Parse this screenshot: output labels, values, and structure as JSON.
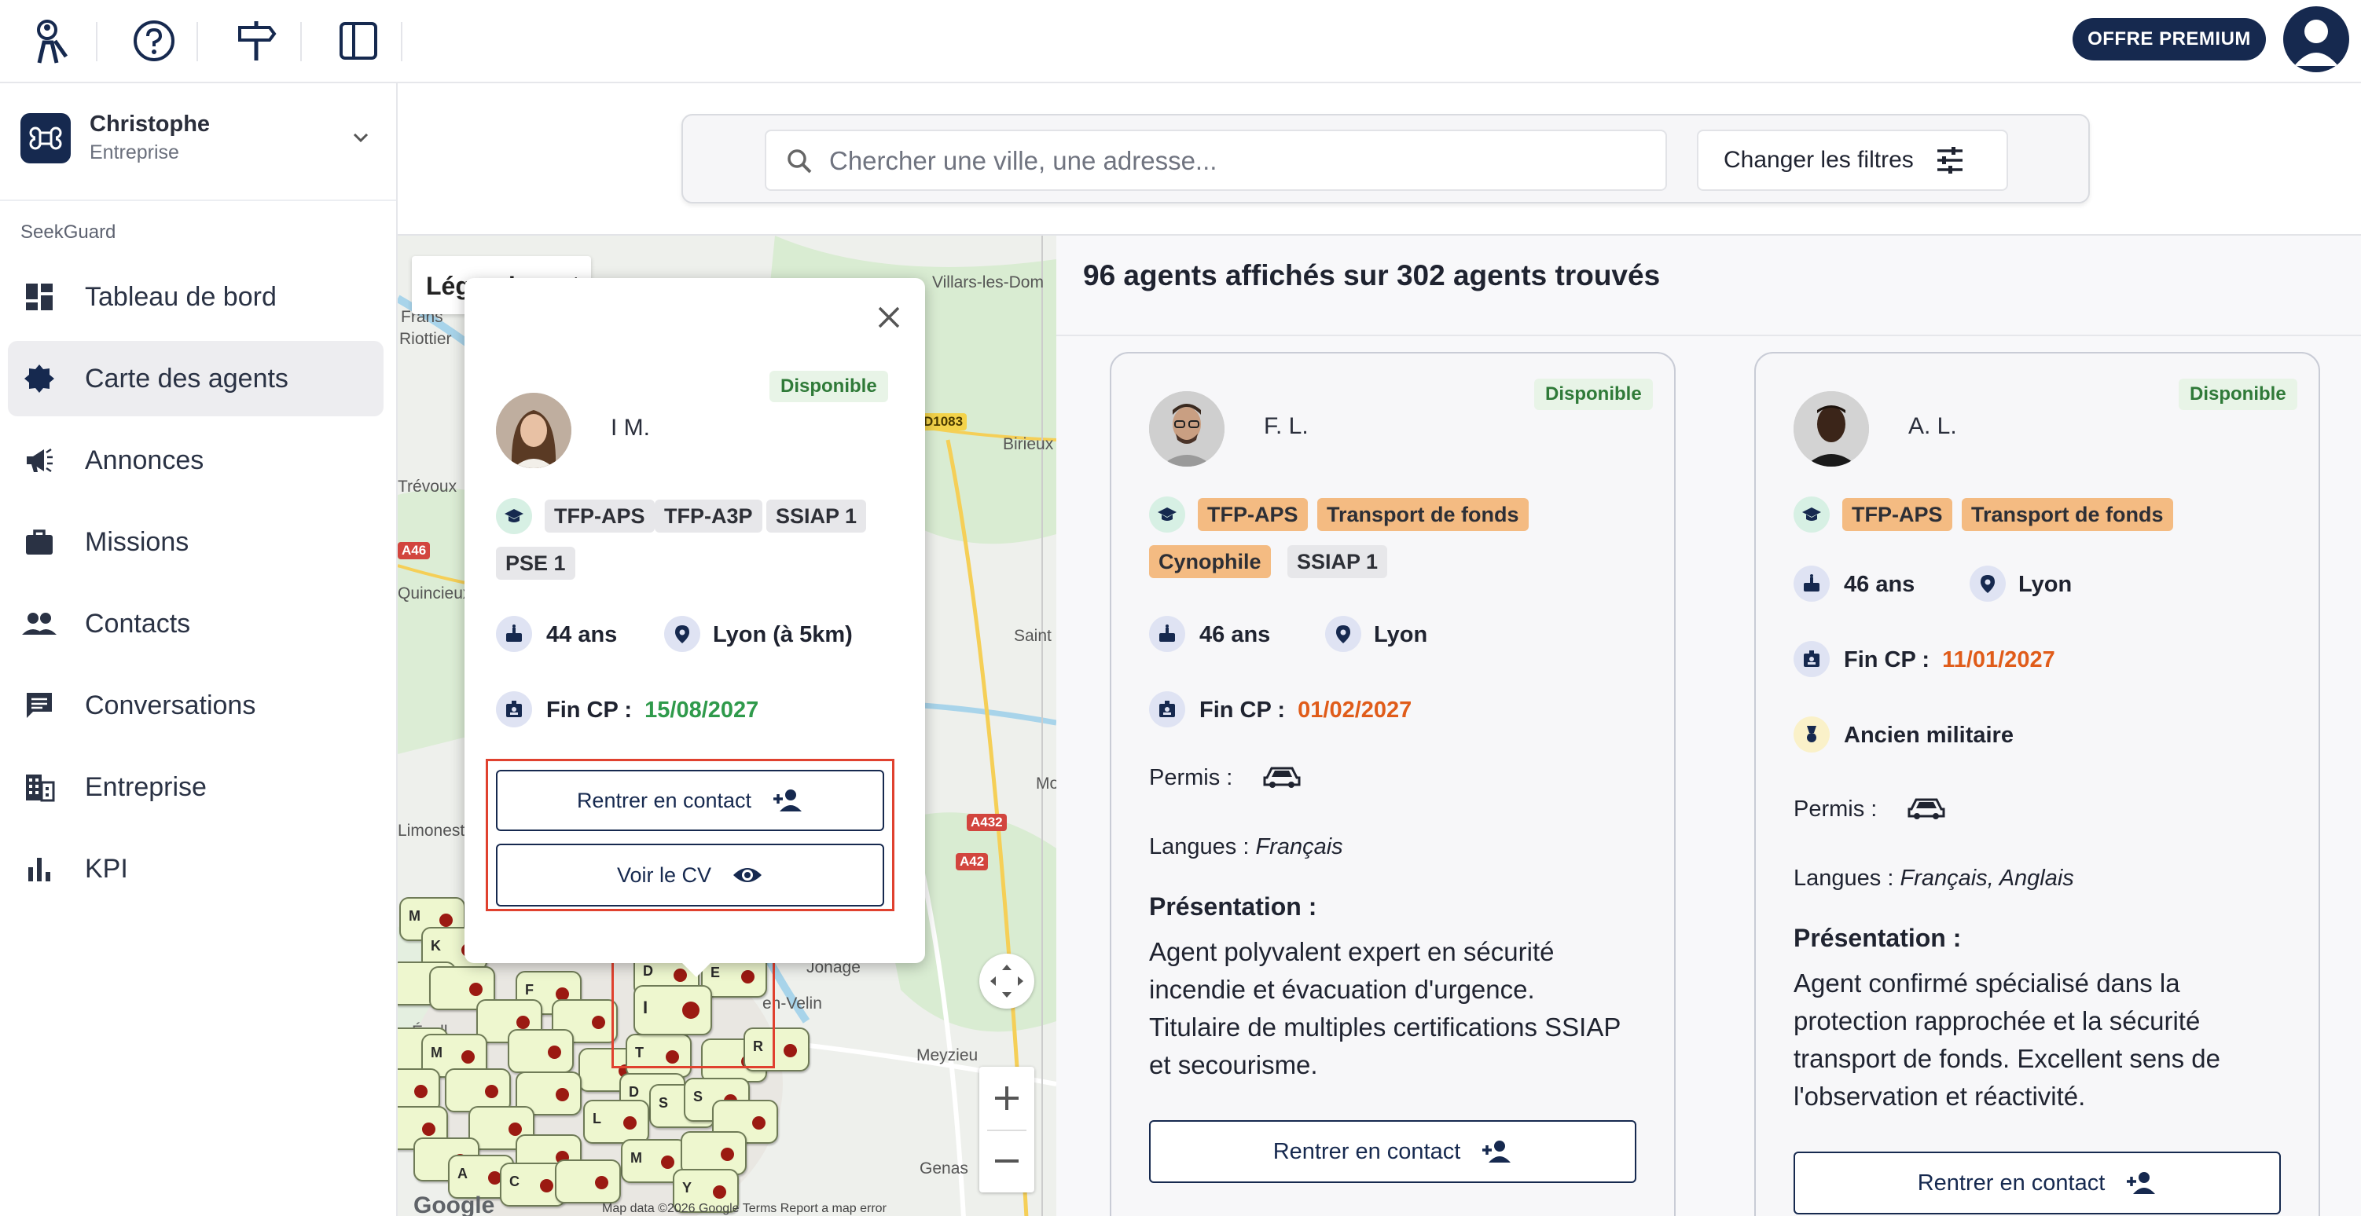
{
  "topbar": {
    "icons": [
      "agent-logo-icon",
      "help-icon",
      "signpost-icon",
      "sidebar-toggle-icon"
    ],
    "premium_label": "OFFRE PREMIUM"
  },
  "org": {
    "name": "Christophe",
    "type": "Entreprise"
  },
  "sidebar": {
    "section": "SeekGuard",
    "items": [
      {
        "label": "Tableau de bord",
        "icon": "dashboard-icon"
      },
      {
        "label": "Carte des agents",
        "icon": "map-badge-icon",
        "active": true
      },
      {
        "label": "Annonces",
        "icon": "megaphone-icon"
      },
      {
        "label": "Missions",
        "icon": "briefcase-icon"
      },
      {
        "label": "Contacts",
        "icon": "people-icon"
      },
      {
        "label": "Conversations",
        "icon": "chat-icon"
      },
      {
        "label": "Entreprise",
        "icon": "building-icon"
      },
      {
        "label": "KPI",
        "icon": "bar-chart-icon"
      }
    ]
  },
  "search": {
    "placeholder": "Chercher une ville, une adresse...",
    "filter_label": "Changer les filtres"
  },
  "map": {
    "legend": "Légende",
    "legend_toggle": "+",
    "places": [
      "Villars-les-Dom",
      "Frans",
      "Riottier",
      "Birieux",
      "Trévoux",
      "Quincieux",
      "Saint",
      "Mo",
      "Limonest",
      "Jonage",
      "en-Velin",
      "Écull",
      "Meyzieu",
      "Genas"
    ],
    "roads": [
      "D1083",
      "A46",
      "A432",
      "A42"
    ],
    "footer": "Map data ©2026 Google   Terms   Report a map error",
    "google": "Google",
    "marker_letters": [
      "M",
      "K",
      "F",
      "D",
      "E",
      "I",
      "R",
      "M",
      "T",
      "D",
      "S",
      "S",
      "L",
      "M",
      "A",
      "Y",
      "C"
    ],
    "popup": {
      "status": "Disponible",
      "name": "I M.",
      "certs": [
        "TFP-APS",
        "TFP-A3P",
        "SSIAP 1",
        "PSE 1"
      ],
      "age": "44 ans",
      "location": "Lyon (à 5km)",
      "fin_cp_label": "Fin CP :",
      "fin_cp_date": "15/08/2027",
      "contact_label": "Rentrer en contact",
      "cv_label": "Voir le CV"
    }
  },
  "results": {
    "summary": "96 agents affichés sur 302 agents trouvés",
    "cards": [
      {
        "status": "Disponible",
        "name": "F. L.",
        "certs": [
          "TFP-APS",
          "Transport de fonds",
          "Cynophile",
          "SSIAP 1"
        ],
        "age": "46 ans",
        "location": "Lyon",
        "fin_cp_label": "Fin CP :",
        "fin_cp_date": "01/02/2027",
        "permis_label": "Permis :",
        "langues_label": "Langues :",
        "langues": "Français",
        "presentation_label": "Présentation :",
        "presentation": "Agent polyvalent expert en sécurité incendie et évacuation d'urgence. Titulaire de multiples certifications SSIAP et secourisme.",
        "contact_label": "Rentrer en contact"
      },
      {
        "status": "Disponible",
        "name": "A. L.",
        "certs": [
          "TFP-APS",
          "Transport de fonds"
        ],
        "age": "46 ans",
        "location": "Lyon",
        "fin_cp_label": "Fin CP :",
        "fin_cp_date": "11/01/2027",
        "military": "Ancien militaire",
        "permis_label": "Permis :",
        "langues_label": "Langues :",
        "langues": "Français, Anglais",
        "presentation_label": "Présentation :",
        "presentation": "Agent confirmé spécialisé dans la protection rapprochée et la sécurité transport de fonds. Excellent sens de l'observation et réactivité.",
        "contact_label": "Rentrer en contact"
      }
    ]
  },
  "colors": {
    "navy": "#16294f",
    "available_bg": "#e8f4e7",
    "available_fg": "#2f7a38",
    "tag_orange": "#f4bb82",
    "date_green": "#2f9a4b",
    "date_orange": "#e05c1a",
    "highlight": "#e0412f"
  }
}
